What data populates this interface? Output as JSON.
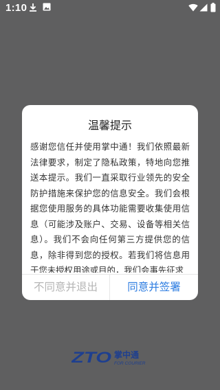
{
  "status_bar": {
    "time": "1:10",
    "icons": [
      "download-icon",
      "gallery-icon",
      "wifi-icon",
      "signal-icon",
      "battery-icon"
    ]
  },
  "dialog": {
    "title": "温馨提示",
    "body": "感谢您信任并使用掌中通！我们依照最新法律要求，制定了隐私政策，特地向您推送本提示。我们一直采取行业领先的安全防护措施来保护您的信息安全。我们会根据您使用服务的具体功能需要收集使用信息（可能涉及账户、交易、设备等相关信息）。我们不会向任何第三方提供您的信息，除非得到您的授权。若我们将信息用于您未授权用途或目的，我们会事先征求",
    "disagree_label": "不同意并退出",
    "agree_label": "同意并签署"
  },
  "logo": {
    "mark": "ZTO",
    "name": "掌中通",
    "tagline": "FOR COURIER"
  },
  "colors": {
    "background": "#5f5f60",
    "accent": "#2e7de1",
    "disabled_text": "#b5b5b5",
    "logo_blue": "#1e3f8f"
  }
}
